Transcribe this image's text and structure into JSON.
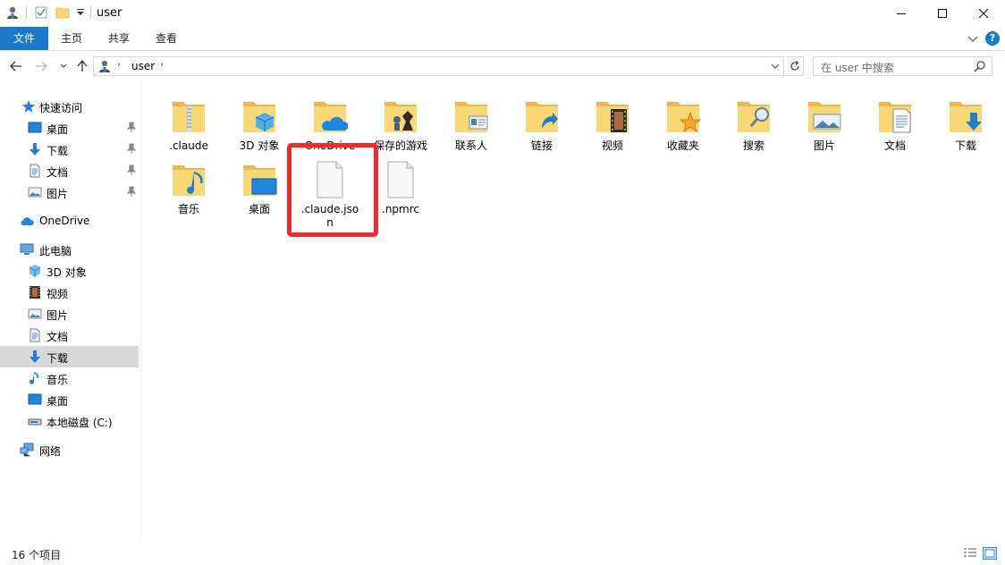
{
  "window": {
    "title": "user",
    "minimize": "minimize",
    "maximize": "maximize",
    "close": "close"
  },
  "ribbon": {
    "tabs": [
      "文件",
      "主页",
      "共享",
      "查看"
    ],
    "help": "?"
  },
  "address": {
    "path": "user",
    "search_placeholder": "在 user 中搜索"
  },
  "sidebar": {
    "items": [
      {
        "label": "快速访问",
        "icon": "star-icon"
      },
      {
        "label": "桌面",
        "icon": "desktop-icon",
        "pinned": true
      },
      {
        "label": "下载",
        "icon": "download-icon",
        "pinned": true
      },
      {
        "label": "文档",
        "icon": "document-icon",
        "pinned": true
      },
      {
        "label": "图片",
        "icon": "picture-icon",
        "pinned": true
      },
      {
        "label": "OneDrive",
        "icon": "cloud-icon"
      },
      {
        "label": "此电脑",
        "icon": "computer-icon"
      },
      {
        "label": "3D 对象",
        "icon": "cube-icon"
      },
      {
        "label": "视频",
        "icon": "video-icon"
      },
      {
        "label": "图片",
        "icon": "picture-icon"
      },
      {
        "label": "文档",
        "icon": "document-icon"
      },
      {
        "label": "下载",
        "icon": "download-icon",
        "selected": true
      },
      {
        "label": "音乐",
        "icon": "music-icon"
      },
      {
        "label": "桌面",
        "icon": "desktop-icon"
      },
      {
        "label": "本地磁盘 (C:)",
        "icon": "drive-icon"
      },
      {
        "label": "网络",
        "icon": "network-icon"
      }
    ]
  },
  "files": [
    {
      "name": ".claude",
      "type": "folder",
      "overlay": "zip"
    },
    {
      "name": "3D 对象",
      "type": "folder",
      "overlay": "cube"
    },
    {
      "name": "OneDrive",
      "type": "folder",
      "overlay": "cloud"
    },
    {
      "name": "保存的游戏",
      "type": "folder",
      "overlay": "game"
    },
    {
      "name": "联系人",
      "type": "folder",
      "overlay": "contact"
    },
    {
      "name": "链接",
      "type": "folder",
      "overlay": "link"
    },
    {
      "name": "视频",
      "type": "folder",
      "overlay": "video"
    },
    {
      "name": "收藏夹",
      "type": "folder",
      "overlay": "star"
    },
    {
      "name": "搜索",
      "type": "folder",
      "overlay": "search"
    },
    {
      "name": "图片",
      "type": "folder",
      "overlay": "picture"
    },
    {
      "name": "文档",
      "type": "folder",
      "overlay": "doc"
    },
    {
      "name": "下载",
      "type": "folder",
      "overlay": "download"
    },
    {
      "name": "音乐",
      "type": "folder",
      "overlay": "music"
    },
    {
      "name": "桌面",
      "type": "folder",
      "overlay": "desktop"
    },
    {
      "name": ".claude.json",
      "type": "file",
      "label_lines": [
        ".claude.jso",
        "n"
      ]
    },
    {
      "name": ".npmrc",
      "type": "file"
    }
  ],
  "status": {
    "count": "16 个项目"
  },
  "colors": {
    "accent": "#1979ca",
    "folder": "#f8d775",
    "highlight": "#ee2a2e",
    "selected": "#d9d9d9"
  }
}
